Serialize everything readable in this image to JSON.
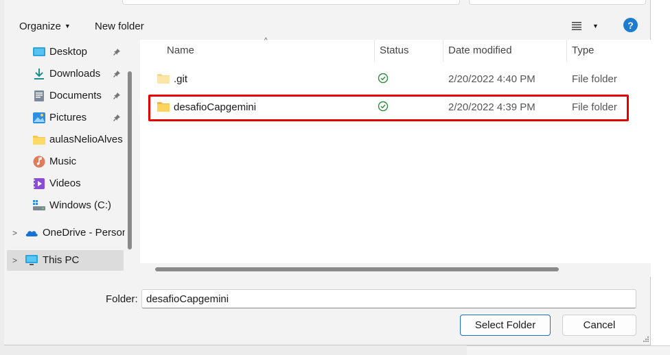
{
  "toolbar": {
    "organize_label": "Organize",
    "new_folder_label": "New folder",
    "help_label": "?"
  },
  "nav": {
    "quick_access": [
      {
        "label": "Desktop",
        "icon": "desktop-icon",
        "pinned": true
      },
      {
        "label": "Downloads",
        "icon": "download-icon",
        "pinned": true
      },
      {
        "label": "Documents",
        "icon": "documents-icon",
        "pinned": true
      },
      {
        "label": "Pictures",
        "icon": "pictures-icon",
        "pinned": true
      },
      {
        "label": "aulasNelioAlves",
        "icon": "folder-icon",
        "pinned": false
      },
      {
        "label": "Music",
        "icon": "music-icon",
        "pinned": false
      },
      {
        "label": "Videos",
        "icon": "videos-icon",
        "pinned": false
      },
      {
        "label": "Windows (C:)",
        "icon": "drive-icon",
        "pinned": false
      }
    ],
    "tree": [
      {
        "label": "OneDrive - Person",
        "icon": "onedrive-icon"
      },
      {
        "label": "This PC",
        "icon": "pc-icon",
        "selected": true
      }
    ]
  },
  "columns": {
    "name": "Name",
    "status": "Status",
    "date": "Date modified",
    "type": "Type"
  },
  "files": [
    {
      "name": ".git",
      "status": "synced",
      "date": "2/20/2022 4:40 PM",
      "type": "File folder"
    },
    {
      "name": "desafioCapgemini",
      "status": "synced",
      "date": "2/20/2022 4:39 PM",
      "type": "File folder",
      "highlighted": true
    }
  ],
  "footer": {
    "folder_label": "Folder:",
    "folder_value": "desafioCapgemini",
    "select_label": "Select Folder",
    "cancel_label": "Cancel"
  },
  "colors": {
    "accent": "#1d7ccf",
    "highlight": "#e50000",
    "folder": "#f5c84c",
    "status_ok": "#2e8b3d"
  }
}
